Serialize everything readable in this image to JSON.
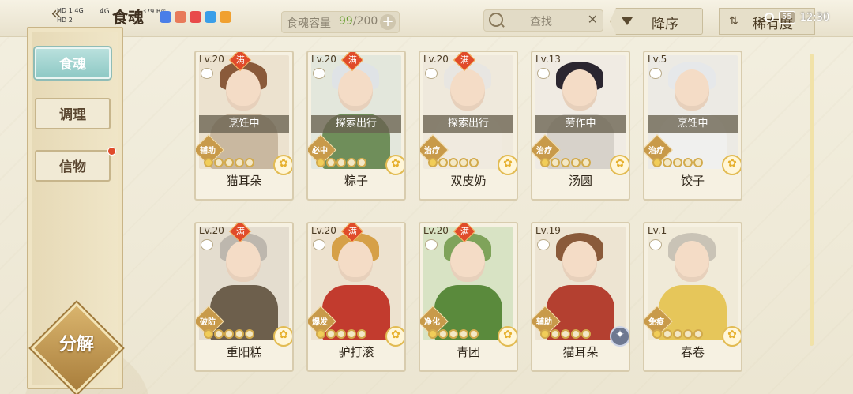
{
  "status_bar": {
    "left_top": "HD 1 4G",
    "left_bottom": "HD 2",
    "signal": "4G",
    "speed": "379 B/s",
    "battery": "55",
    "time": "12:30"
  },
  "header": {
    "back_icon": "back-arrow-icon",
    "title": "食魂",
    "capacity_label": "食魂容量",
    "capacity_current": "99",
    "capacity_total": "/200",
    "capacity_add": "+",
    "search_placeholder": "查找",
    "search_clear": "✕",
    "sort_label": "降序",
    "sort2_label": "稀有度"
  },
  "sidebar": {
    "items": [
      {
        "label": "食魂",
        "active": true
      },
      {
        "label": "调理",
        "active": false
      },
      {
        "label": "信物",
        "active": false,
        "badge": true
      }
    ],
    "decompose_label": "分解"
  },
  "cards": [
    {
      "level": "Lv.20",
      "full": "满",
      "status": "烹饪中",
      "role": "辅助",
      "name": "猫耳朵",
      "element": "flower-icon"
    },
    {
      "level": "Lv.20",
      "full": "满",
      "status": "探索出行",
      "role": "必中",
      "name": "粽子",
      "element": "flower-icon"
    },
    {
      "level": "Lv.20",
      "full": "满",
      "status": "探索出行",
      "role": "治疗",
      "name": "双皮奶",
      "element": "flower-icon"
    },
    {
      "level": "Lv.13",
      "full": "",
      "status": "劳作中",
      "role": "治疗",
      "name": "汤圆",
      "element": "flower-icon"
    },
    {
      "level": "Lv.5",
      "full": "",
      "status": "烹饪中",
      "role": "治疗",
      "name": "饺子",
      "element": "flower-icon"
    },
    {
      "level": "Lv.20",
      "full": "满",
      "status": "",
      "role": "破防",
      "name": "重阳糕",
      "element": "flower-icon"
    },
    {
      "level": "Lv.20",
      "full": "满",
      "status": "",
      "role": "爆发",
      "name": "驴打滚",
      "element": "flower-icon"
    },
    {
      "level": "Lv.20",
      "full": "满",
      "status": "",
      "role": "净化",
      "name": "青团",
      "element": "flower-icon"
    },
    {
      "level": "Lv.19",
      "full": "",
      "status": "",
      "role": "辅助",
      "name": "猫耳朵",
      "element": "star-dark-icon"
    },
    {
      "level": "Lv.1",
      "full": "",
      "status": "",
      "role": "免疫",
      "name": "春卷",
      "element": "flower-icon"
    }
  ],
  "colors": {
    "accent": "#8ec9c5",
    "badge_red": "#e04b2a",
    "gold": "#d2aa4c"
  }
}
